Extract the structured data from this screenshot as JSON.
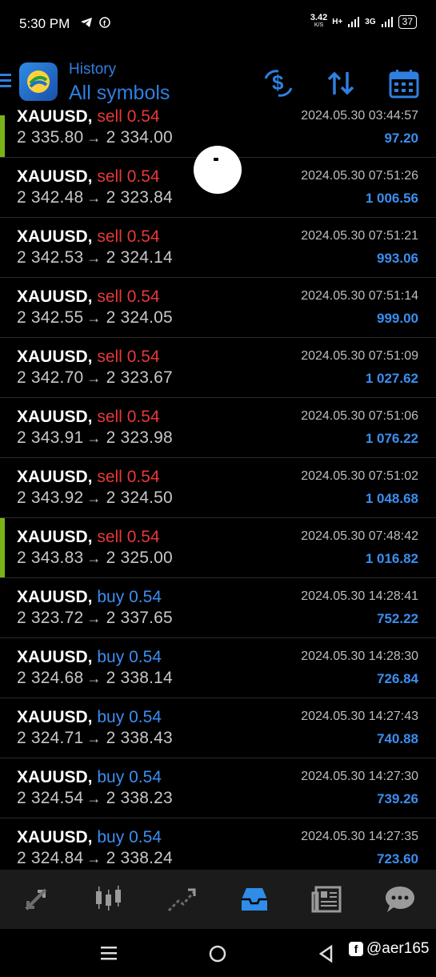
{
  "status_bar": {
    "time": "5:30 PM",
    "net_speed": "3.42",
    "net_unit": "K/S",
    "net_type_1": "H+",
    "net_type_2": "3G",
    "battery": "37"
  },
  "header": {
    "subtitle": "History",
    "title": "All symbols"
  },
  "trades": [
    {
      "symbol": "XAUUSD,",
      "side": "sell",
      "volume": "0.54",
      "open": "2 335.80",
      "close": "2 334.00",
      "time": "2024.05.30 03:44:57",
      "profit": "97.20",
      "marker": true
    },
    {
      "symbol": "XAUUSD,",
      "side": "sell",
      "volume": "0.54",
      "open": "2 342.48",
      "close": "2 323.84",
      "time": "2024.05.30 07:51:26",
      "profit": "1 006.56",
      "marker": false
    },
    {
      "symbol": "XAUUSD,",
      "side": "sell",
      "volume": "0.54",
      "open": "2 342.53",
      "close": "2 324.14",
      "time": "2024.05.30 07:51:21",
      "profit": "993.06",
      "marker": false
    },
    {
      "symbol": "XAUUSD,",
      "side": "sell",
      "volume": "0.54",
      "open": "2 342.55",
      "close": "2 324.05",
      "time": "2024.05.30 07:51:14",
      "profit": "999.00",
      "marker": false
    },
    {
      "symbol": "XAUUSD,",
      "side": "sell",
      "volume": "0.54",
      "open": "2 342.70",
      "close": "2 323.67",
      "time": "2024.05.30 07:51:09",
      "profit": "1 027.62",
      "marker": false
    },
    {
      "symbol": "XAUUSD,",
      "side": "sell",
      "volume": "0.54",
      "open": "2 343.91",
      "close": "2 323.98",
      "time": "2024.05.30 07:51:06",
      "profit": "1 076.22",
      "marker": false
    },
    {
      "symbol": "XAUUSD,",
      "side": "sell",
      "volume": "0.54",
      "open": "2 343.92",
      "close": "2 324.50",
      "time": "2024.05.30 07:51:02",
      "profit": "1 048.68",
      "marker": false
    },
    {
      "symbol": "XAUUSD,",
      "side": "sell",
      "volume": "0.54",
      "open": "2 343.83",
      "close": "2 325.00",
      "time": "2024.05.30 07:48:42",
      "profit": "1 016.82",
      "marker": true
    },
    {
      "symbol": "XAUUSD,",
      "side": "buy",
      "volume": "0.54",
      "open": "2 323.72",
      "close": "2 337.65",
      "time": "2024.05.30 14:28:41",
      "profit": "752.22",
      "marker": false
    },
    {
      "symbol": "XAUUSD,",
      "side": "buy",
      "volume": "0.54",
      "open": "2 324.68",
      "close": "2 338.14",
      "time": "2024.05.30 14:28:30",
      "profit": "726.84",
      "marker": false
    },
    {
      "symbol": "XAUUSD,",
      "side": "buy",
      "volume": "0.54",
      "open": "2 324.71",
      "close": "2 338.43",
      "time": "2024.05.30 14:27:43",
      "profit": "740.88",
      "marker": false
    },
    {
      "symbol": "XAUUSD,",
      "side": "buy",
      "volume": "0.54",
      "open": "2 324.54",
      "close": "2 338.23",
      "time": "2024.05.30 14:27:30",
      "profit": "739.26",
      "marker": false
    },
    {
      "symbol": "XAUUSD,",
      "side": "buy",
      "volume": "0.54",
      "open": "2 324.84",
      "close": "2 338.24",
      "time": "2024.05.30 14:27:35",
      "profit": "723.60",
      "marker": false
    }
  ],
  "colors": {
    "accent": "#2f7fe0",
    "sell": "#e83838",
    "buy": "#3b8ef0",
    "marker": "#7ab317"
  },
  "bottom_nav": [
    "quotes-icon",
    "chart-icon",
    "trade-icon",
    "history-icon",
    "news-icon",
    "chat-icon"
  ],
  "watermark": "@aer165"
}
